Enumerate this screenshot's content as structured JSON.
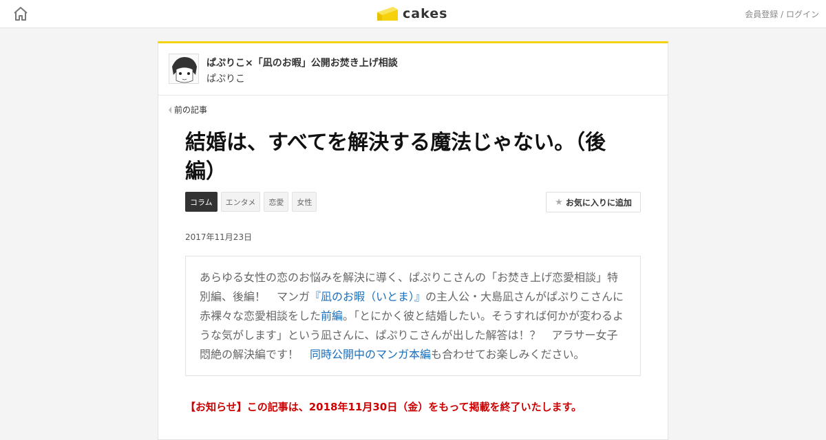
{
  "header": {
    "logo_text": "cakes",
    "auth_register": "会員登録",
    "auth_sep": " / ",
    "auth_login": "ログイン"
  },
  "series": {
    "title": "ぱぷりこ×「凪のお暇」公開お焚き上げ相談",
    "author": "ぱぷりこ"
  },
  "nav": {
    "prev_label": "前の記事"
  },
  "article": {
    "title": "結婚は、すべてを解決する魔法じゃない。（後編）",
    "tags": [
      {
        "label": "コラム",
        "active": true
      },
      {
        "label": "エンタメ",
        "active": false
      },
      {
        "label": "恋愛",
        "active": false
      },
      {
        "label": "女性",
        "active": false
      }
    ],
    "fav_label": "お気に入りに追加",
    "date": "2017年11月23日",
    "lead": {
      "t1": "あらゆる女性の恋のお悩みを解決に導く、ぱぷりこさんの「お焚き上げ恋愛相談」特別編、後編！　マンガ",
      "link1": "『凪のお暇（いとま）』",
      "t2": "の主人公・大島凪さんがぱぷりこさんに赤裸々な恋愛相談をした",
      "link2": "前編",
      "t3": "。「とにかく彼と結婚したい。そうすれば何かが変わるような気がします」という凪さんに、ぱぷりこさんが出した解答は！？　アラサー女子悶絶の解決編です！　",
      "link3": "同時公開中のマンガ本編",
      "t4": "も合わせてお楽しみください。"
    },
    "notice": "【お知らせ】この記事は、2018年11月30日（金）をもって掲載を終了いたします。"
  },
  "colors": {
    "accent": "#f5d20c",
    "link": "#1a6fbd",
    "notice": "#cc0000"
  }
}
